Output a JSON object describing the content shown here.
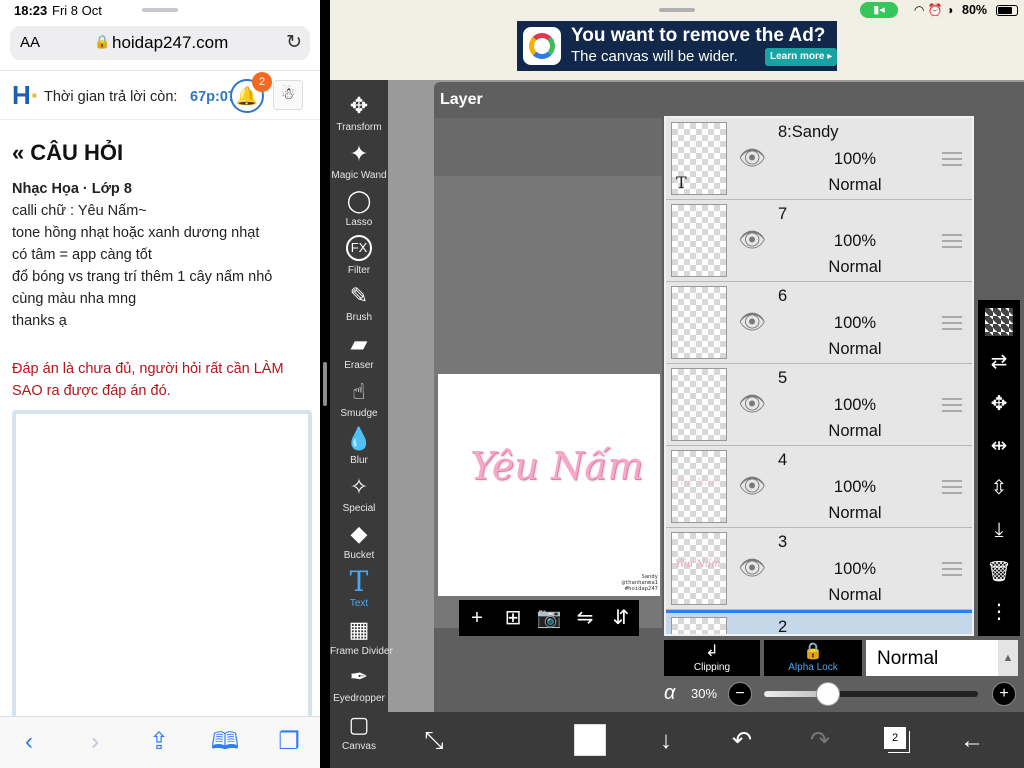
{
  "safari": {
    "status": {
      "time": "18:23",
      "date": "Fri 8 Oct"
    },
    "urlbar": {
      "aa": "AA",
      "domain": "hoidap247.com",
      "lock": "lock-icon",
      "reload": "reload-icon"
    },
    "site": {
      "timer_label": "Thời gian trả lời còn:",
      "timer_value": "67p:07s",
      "notification_count": "2"
    },
    "question": {
      "heading_icon": "«",
      "heading": "CÂU HỎI",
      "subject": "Nhạc Họa · Lớp 8",
      "lines": [
        "calli chữ : Yêu Nấm~",
        "tone hồng nhạt hoặc xanh dương nhạt",
        "có tâm = app càng tốt",
        "đổ bóng vs trang trí thêm 1 cây nấm nhỏ",
        "cùng màu nha mng",
        "thanks ạ"
      ],
      "warning": "Đáp án là chưa đủ, người hỏi rất cần LÀM SAO ra được đáp án đó."
    },
    "toolbar_icons": [
      "back-icon",
      "forward-icon",
      "share-icon",
      "bookmarks-icon",
      "tabs-icon"
    ]
  },
  "ibis": {
    "status": {
      "battery_pct": "80%",
      "battery_level": 0.8
    },
    "ad": {
      "title": "You want to remove the Ad?",
      "subtitle": "The canvas will be wider.",
      "cta": "Learn more ▸"
    },
    "tools": [
      {
        "label": "Transform",
        "icon": "✥"
      },
      {
        "label": "Magic Wand",
        "icon": "✦"
      },
      {
        "label": "Lasso",
        "icon": "◯"
      },
      {
        "label": "Filter",
        "icon": "FX"
      },
      {
        "label": "Brush",
        "icon": "✎"
      },
      {
        "label": "Eraser",
        "icon": "▰"
      },
      {
        "label": "Smudge",
        "icon": "☝"
      },
      {
        "label": "Blur",
        "icon": "💧"
      },
      {
        "label": "Special",
        "icon": "✧"
      },
      {
        "label": "Bucket",
        "icon": "◆"
      },
      {
        "label": "Text",
        "icon": "T"
      },
      {
        "label": "Frame Divider",
        "icon": "▦"
      },
      {
        "label": "Eyedropper",
        "icon": "✒"
      },
      {
        "label": "Canvas",
        "icon": "▢"
      }
    ],
    "active_tool": "Text",
    "layer_panel_title": "Layer",
    "canvas": {
      "calligraphy": "Yêu Nấm",
      "signature": [
        "Sandy",
        "@thanhanma1",
        "#hoidap247"
      ]
    },
    "layers": [
      {
        "name": "8:Sandy",
        "opacity": "100%",
        "blend": "Normal",
        "thumb": "text"
      },
      {
        "name": "7",
        "opacity": "100%",
        "blend": "Normal",
        "thumb": "empty"
      },
      {
        "name": "6",
        "opacity": "100%",
        "blend": "Normal",
        "thumb": "empty"
      },
      {
        "name": "5",
        "opacity": "100%",
        "blend": "Normal",
        "thumb": "empty"
      },
      {
        "name": "4",
        "opacity": "100%",
        "blend": "Normal",
        "thumb": "faint"
      },
      {
        "name": "3",
        "opacity": "100%",
        "blend": "Normal",
        "thumb": "art"
      },
      {
        "name": "2",
        "opacity": "",
        "blend": "",
        "thumb": "selected"
      }
    ],
    "layer_options": {
      "clipping": "Clipping",
      "alpha_lock": "Alpha Lock",
      "blend_mode": "Normal",
      "alpha_symbol": "α",
      "opacity_label": "30%",
      "opacity_value": 0.3
    },
    "bottom": {
      "layer_count": "2"
    },
    "colors": {
      "accent": "#4aa8f0",
      "toolbar": "#3a3a3a",
      "pink": "#f6a8c8"
    }
  }
}
